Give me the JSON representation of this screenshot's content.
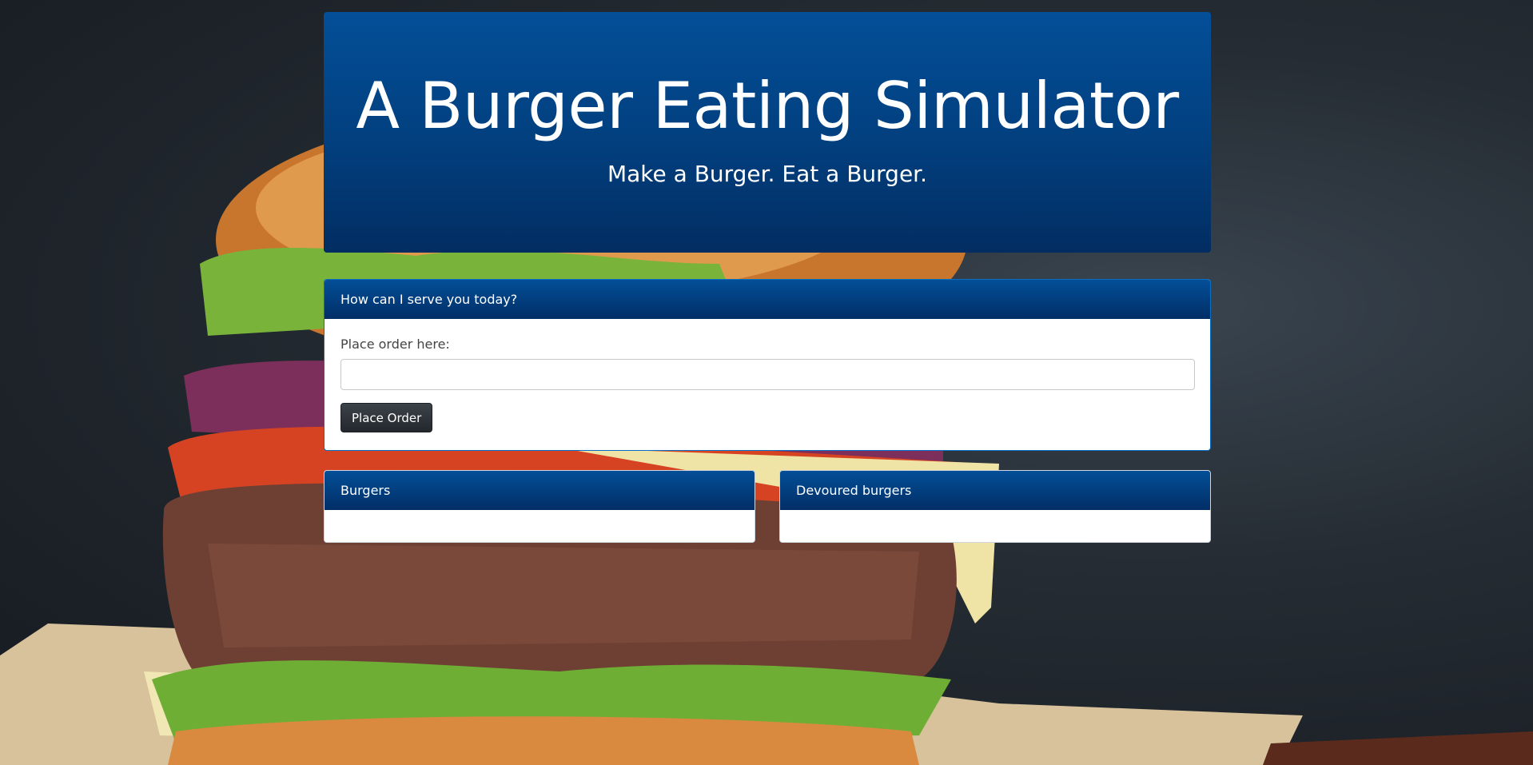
{
  "header": {
    "title": "A Burger Eating Simulator",
    "subtitle": "Make a Burger. Eat a Burger."
  },
  "order": {
    "header": "How can I serve you today?",
    "label": "Place order here:",
    "input_value": "",
    "button_label": "Place Order"
  },
  "lists": {
    "burgers_header": "Burgers",
    "devoured_header": "Devoured burgers"
  },
  "colors": {
    "primary_blue": "#034f98",
    "dark_blue": "#012e66",
    "button_dark": "#343a40"
  }
}
